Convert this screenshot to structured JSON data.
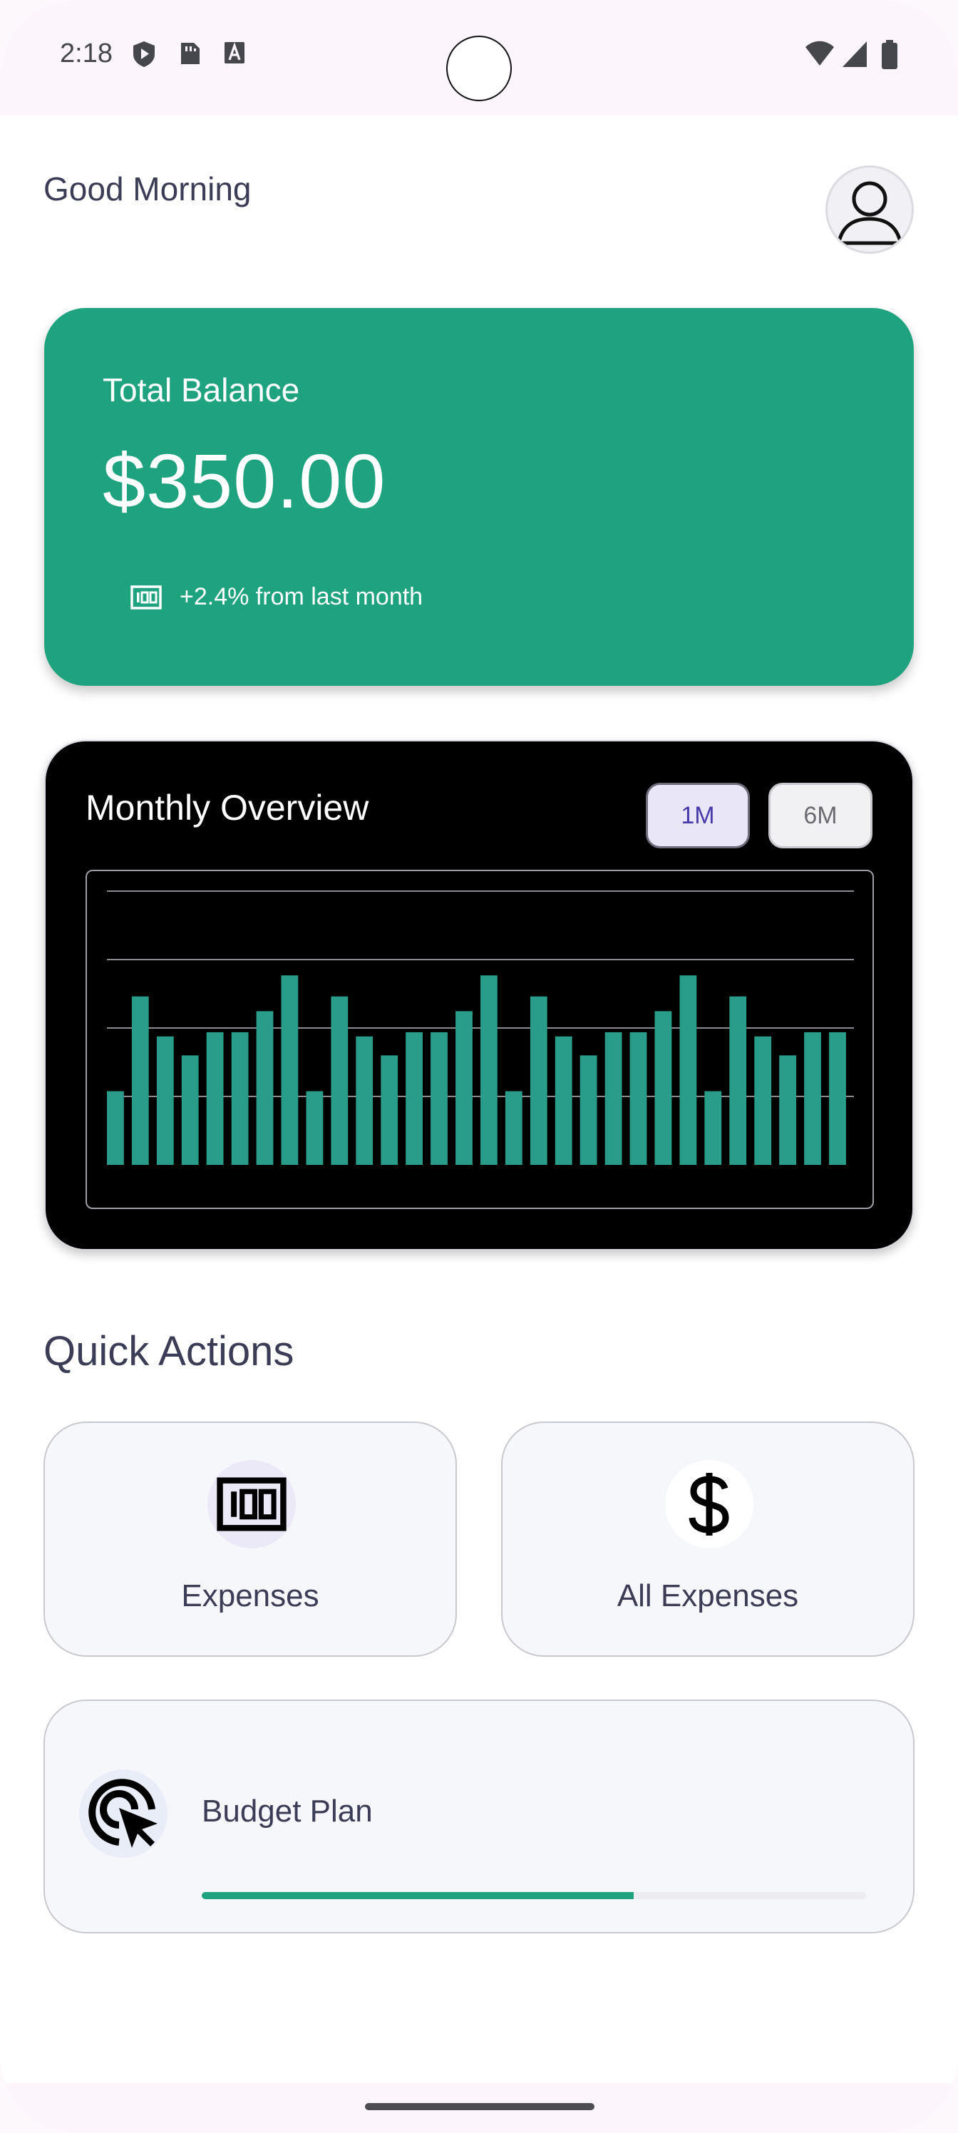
{
  "status_bar": {
    "time": "2:18",
    "left_icons": [
      "shield-play-icon",
      "sim-card-icon",
      "text-a-icon"
    ],
    "right_icons": [
      "wifi-icon",
      "cellular-signal-icon",
      "battery-icon"
    ]
  },
  "header": {
    "greeting": "Good Morning",
    "avatar_icon": "person-icon"
  },
  "balance_card": {
    "label": "Total Balance",
    "amount": "$350.00",
    "trend_icon": "money-100-icon",
    "trend_text": "+2.4% from last month",
    "color": "#1fa37f"
  },
  "overview": {
    "title": "Monthly Overview",
    "ranges": [
      "1M",
      "6M"
    ],
    "selected_range": "1M"
  },
  "chart_data": {
    "type": "bar",
    "values": [
      35,
      80,
      61,
      52,
      63,
      63,
      73,
      90,
      35,
      80,
      61,
      52,
      63,
      63,
      73,
      90,
      35,
      80,
      61,
      52,
      63,
      63,
      73,
      90,
      35,
      80,
      61,
      52,
      63,
      63
    ],
    "ylim": [
      0,
      130
    ],
    "grid": true,
    "bar_color": "#2a9d8a"
  },
  "quick_actions": {
    "title": "Quick Actions",
    "items": [
      {
        "label": "Expenses",
        "icon": "money-100-icon"
      },
      {
        "label": "All Expenses",
        "icon": "dollar-icon"
      }
    ],
    "budget": {
      "label": "Budget Plan",
      "icon": "cursor-target-icon",
      "progress": 0.65
    }
  }
}
